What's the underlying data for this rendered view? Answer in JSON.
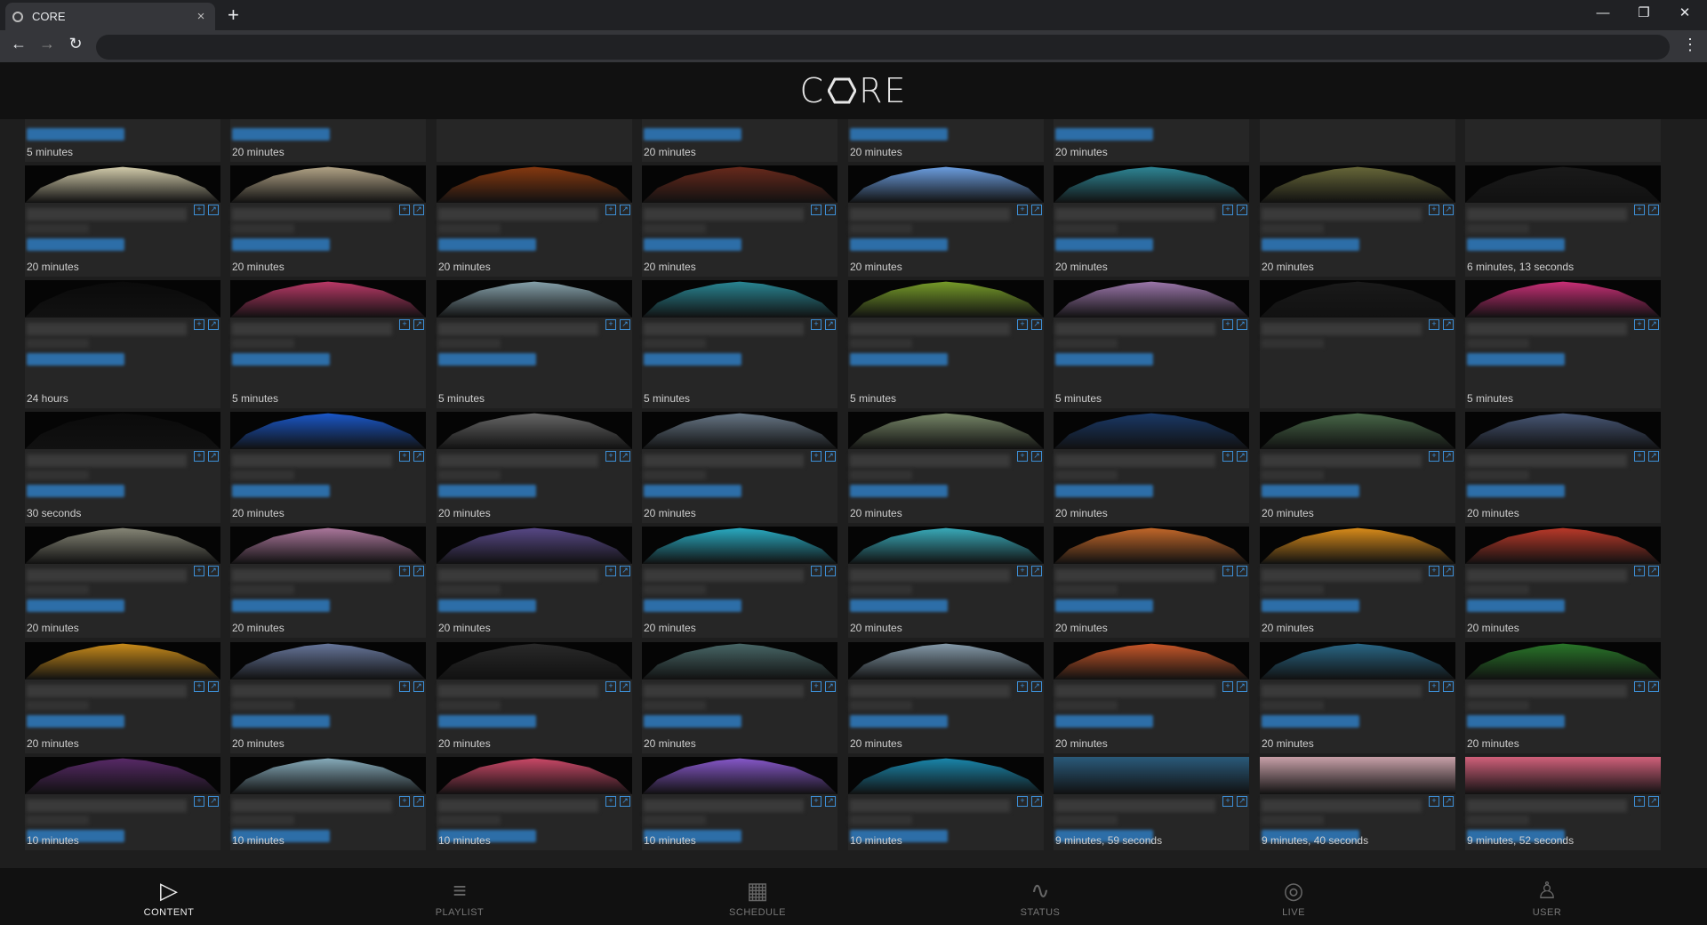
{
  "browser": {
    "tab_title": "CORE",
    "new_tab": "+",
    "tab_close": "×",
    "back": "←",
    "forward": "→",
    "reload": "↻",
    "menu": "⋮",
    "minimize": "—",
    "restore": "❐",
    "close": "✕"
  },
  "app": {
    "logo_left": "C",
    "logo_right": "RE"
  },
  "top_row_durations": [
    "5 minutes",
    "20 minutes",
    "",
    "20 minutes",
    "20 minutes",
    "20 minutes",
    "",
    ""
  ],
  "rows": [
    [
      "20 minutes",
      "20 minutes",
      "20 minutes",
      "20 minutes",
      "20 minutes",
      "20 minutes",
      "20 minutes",
      "6 minutes, 13 seconds"
    ],
    [
      "24 hours",
      "5 minutes",
      "5 minutes",
      "5 minutes",
      "5 minutes",
      "5 minutes",
      "",
      "5 minutes"
    ],
    [
      "30 seconds",
      "20 minutes",
      "20 minutes",
      "20 minutes",
      "20 minutes",
      "20 minutes",
      "20 minutes",
      "20 minutes"
    ],
    [
      "20 minutes",
      "20 minutes",
      "20 minutes",
      "20 minutes",
      "20 minutes",
      "20 minutes",
      "20 minutes",
      "20 minutes"
    ],
    [
      "20 minutes",
      "20 minutes",
      "20 minutes",
      "20 minutes",
      "20 minutes",
      "20 minutes",
      "20 minutes",
      "20 minutes"
    ],
    [
      "10 minutes",
      "10 minutes",
      "10 minutes",
      "10 minutes",
      "10 minutes",
      "9 minutes, 59 seconds",
      "9 minutes, 40 seconds",
      "9 minutes, 52 seconds"
    ]
  ],
  "thumb_colors": [
    [
      "#d9d2b0",
      "#b7a88a",
      "#8a3a10",
      "#6b2a1c",
      "#6fa3e8",
      "#2f8a9a",
      "#6a6a3a",
      "#1a1a1a"
    ],
    [
      "#0a0a0a",
      "#c03a6a",
      "#8aa6b0",
      "#2a8a98",
      "#7aa02a",
      "#a07ab0",
      "#1a1a1a",
      "#d0307a"
    ],
    [
      "#0a0a0a",
      "#1a5ad0",
      "#6a6a6a",
      "#6a7a8a",
      "#7a8a6a",
      "#1a3a6a",
      "#4a6a4a",
      "#4a5a7a"
    ],
    [
      "#8a8a7a",
      "#b07aa0",
      "#5a4a8a",
      "#2ab0c8",
      "#3ab0c0",
      "#c86a2a",
      "#e0901a",
      "#c03a2a"
    ],
    [
      "#d0901a",
      "#6a7aa0",
      "#2a2a2a",
      "#4a6a6a",
      "#8aa0b0",
      "#d05a2a",
      "#2a6a8a",
      "#2a7a2a"
    ],
    [
      "#5a2a6a",
      "#8ab0c0",
      "#d04a6a",
      "#8a5ad0",
      "#1a8ab0",
      "#2a5a7a",
      "#c8a0a8",
      "#d0607a"
    ]
  ],
  "bottom_nav": [
    {
      "label": "CONTENT",
      "icon": "▷"
    },
    {
      "label": "PLAYLIST",
      "icon": "≡"
    },
    {
      "label": "SCHEDULE",
      "icon": "▦"
    },
    {
      "label": "STATUS",
      "icon": "∿"
    },
    {
      "label": "LIVE",
      "icon": "◎"
    },
    {
      "label": "USER",
      "icon": "♙"
    }
  ]
}
